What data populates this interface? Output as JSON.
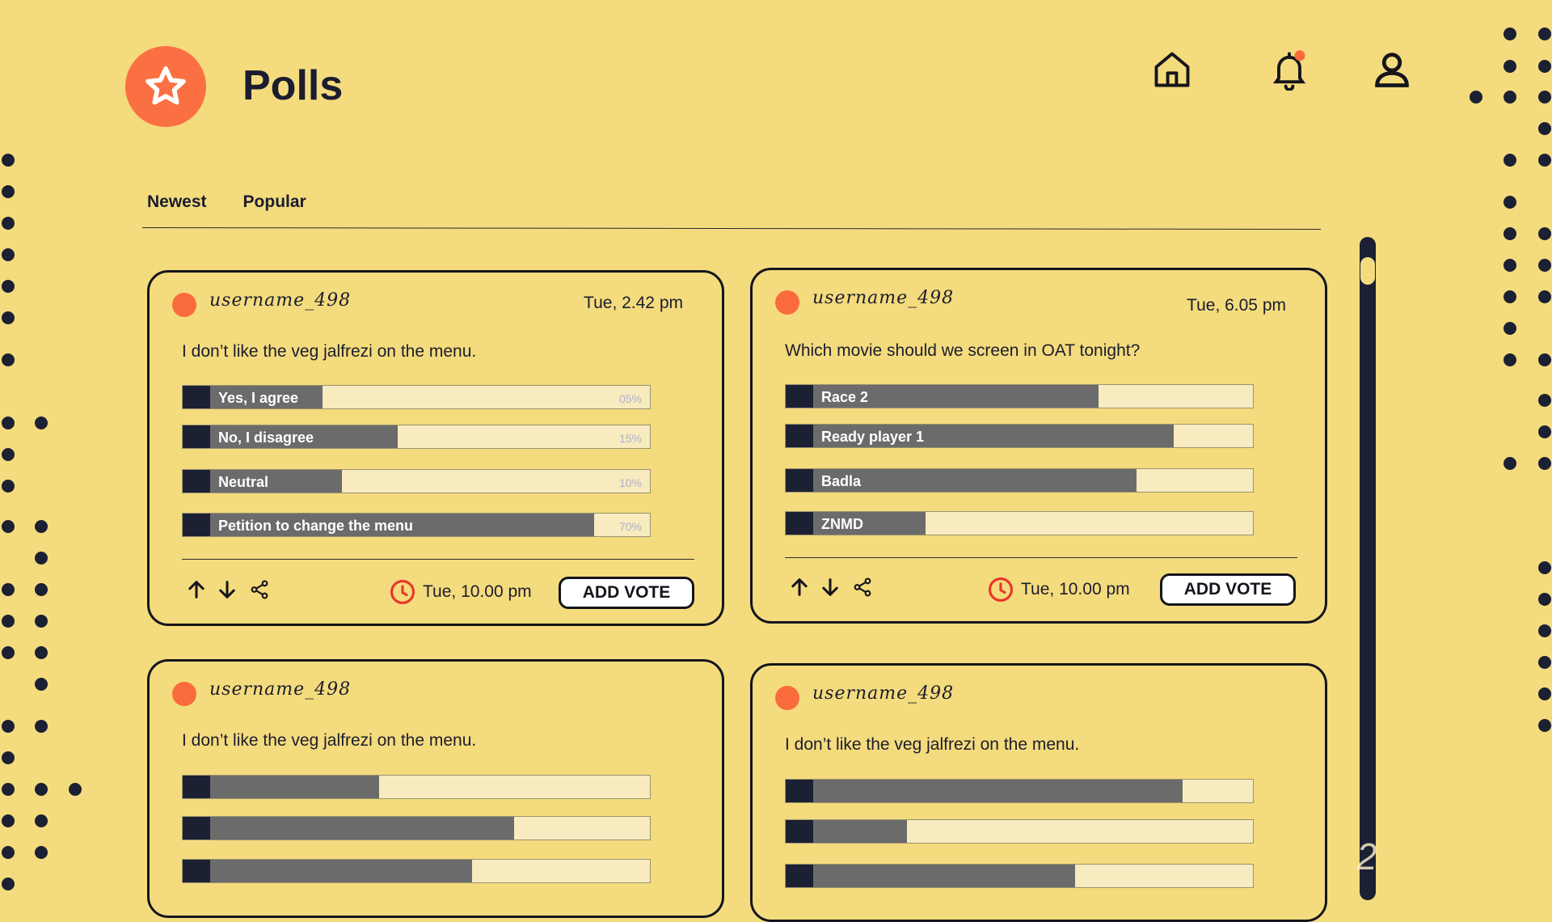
{
  "header": {
    "title": "Polls",
    "logo_icon": "star-icon"
  },
  "nav": {
    "icons": [
      "home-icon",
      "bell-icon",
      "user-icon"
    ],
    "notification_color": "#fa6b3c"
  },
  "tabs": [
    {
      "label": "Newest"
    },
    {
      "label": "Popular"
    }
  ],
  "colors": {
    "background": "#f4db7d",
    "accent": "#fa7043",
    "dark": "#1b2033",
    "bar_fill": "#6b6b6b",
    "bar_empty": "#f7ebbf"
  },
  "polls": [
    {
      "username": "username_498",
      "posted": "Tue, 2.42 pm",
      "question": "I don’t like the veg jalfrezi on the menu.",
      "options": [
        {
          "label": "Yes, I agree",
          "percent": "05%",
          "fill": 0.3
        },
        {
          "label": "No, I disagree",
          "percent": "15%",
          "fill": 0.46
        },
        {
          "label": "Neutral",
          "percent": "10%",
          "fill": 0.34
        },
        {
          "label": "Petition to change the menu",
          "percent": "70%",
          "fill": 0.88
        }
      ],
      "deadline": "Tue, 10.00 pm",
      "vote_label": "ADD VOTE"
    },
    {
      "username": "username_498",
      "posted": "Tue, 6.05 pm",
      "question": "Which movie should we screen in OAT tonight?",
      "options": [
        {
          "label": "Race 2",
          "fill": 0.67
        },
        {
          "label": "Ready player 1",
          "fill": 0.83
        },
        {
          "label": "Badla",
          "fill": 0.75
        },
        {
          "label": "ZNMD",
          "fill": 0.3
        }
      ],
      "deadline": "Tue, 10.00 pm",
      "vote_label": "ADD VOTE"
    },
    {
      "username": "username_498",
      "question": "I don’t like the veg jalfrezi on the menu.",
      "options": [
        {
          "fill": 0.42
        },
        {
          "fill": 0.71
        },
        {
          "fill": 0.62
        }
      ]
    },
    {
      "username": "username_498",
      "question": "I don’t like the veg jalfrezi on the menu.",
      "options": [
        {
          "fill": 0.85
        },
        {
          "fill": 0.26
        },
        {
          "fill": 0.62
        }
      ]
    }
  ]
}
